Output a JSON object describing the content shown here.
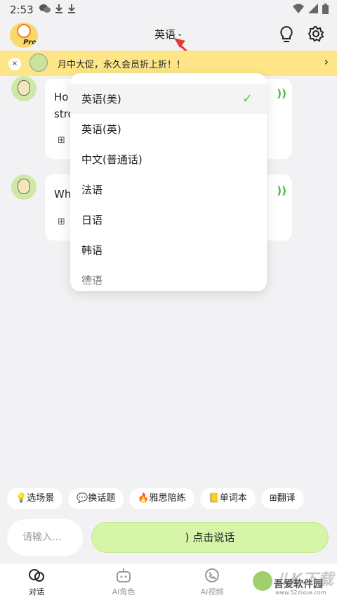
{
  "status_bar": {
    "time": "2:53",
    "left_icons": [
      "wechat-icon",
      "download-icon",
      "download-icon"
    ],
    "right_icons": [
      "wifi-icon",
      "signal-icon",
      "battery-icon"
    ]
  },
  "header": {
    "pro_badge": "Pro",
    "language": "英语",
    "icons": [
      "lightbulb-icon",
      "gear-icon"
    ]
  },
  "promo": {
    "close": "×",
    "text": "月中大促，永久会员折上折！！",
    "arrow": "›"
  },
  "chat": {
    "messages": [
      {
        "line1": "Ho",
        "line2": "stro",
        "tool": "⊞"
      },
      {
        "line1": "Wh",
        "tool": "⊞"
      }
    ],
    "sound": "))"
  },
  "dropdown": {
    "items": [
      {
        "label": "英语(美)",
        "selected": true
      },
      {
        "label": "英语(英)",
        "selected": false
      },
      {
        "label": "中文(普通话)",
        "selected": false
      },
      {
        "label": "法语",
        "selected": false
      },
      {
        "label": "日语",
        "selected": false
      },
      {
        "label": "韩语",
        "selected": false
      },
      {
        "label": "德语",
        "selected": false
      }
    ],
    "check": "✓"
  },
  "chips": [
    {
      "icon": "lightbulb-icon",
      "glyph": "💡",
      "label": "选场景"
    },
    {
      "icon": "chat-bubble-icon",
      "glyph": "💬",
      "label": "换话题"
    },
    {
      "icon": "fire-icon",
      "glyph": "🔥",
      "label": "雅思陪练"
    },
    {
      "icon": "notebook-icon",
      "glyph": "📒",
      "label": "单词本"
    },
    {
      "icon": "translate-icon",
      "glyph": "⊞",
      "label": "翻译"
    }
  ],
  "input": {
    "placeholder": "请输入..."
  },
  "speak_button": {
    "label": "点击说话",
    "icon": "sound-wave-icon"
  },
  "bottom_nav": [
    {
      "label": "对话",
      "icon": "chat-icon",
      "active": true
    },
    {
      "label": "AI角色",
      "icon": "robot-icon",
      "active": false
    },
    {
      "label": "AI视频",
      "icon": "video-call-icon",
      "active": false
    }
  ],
  "watermark": {
    "big": "ルK下载",
    "name": "吾爱软件园",
    "url": "www.52zixue.com"
  },
  "colors": {
    "accent_green": "#6cc24a",
    "promo_yellow": "#fde588",
    "speak_green": "#d6f5a8",
    "arrow_red": "#e53935"
  }
}
